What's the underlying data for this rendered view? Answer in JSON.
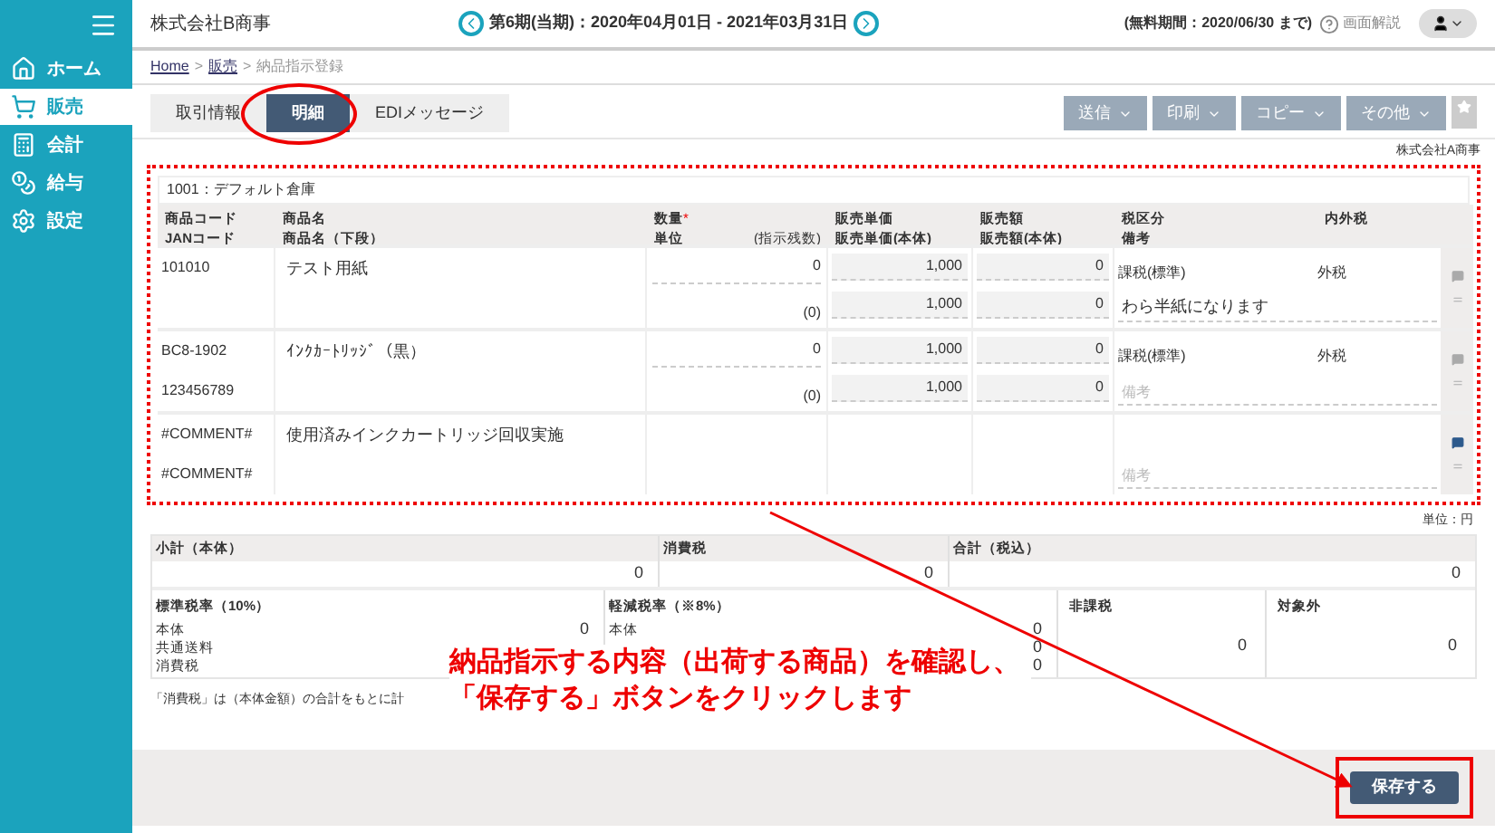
{
  "header": {
    "company": "株式会社B商事",
    "period": "第6期(当期)：2020年04月01日 - 2021年03月31日",
    "trial": "(無料期間：2020/06/30 まで)",
    "help": "画面解説"
  },
  "sidebar": {
    "items": [
      {
        "label": "ホーム",
        "selected": false
      },
      {
        "label": "販売",
        "selected": true
      },
      {
        "label": "会計",
        "selected": false
      },
      {
        "label": "給与",
        "selected": false
      },
      {
        "label": "設定",
        "selected": false
      }
    ]
  },
  "breadcrumb": [
    {
      "kind": "link",
      "label": "Home"
    },
    {
      "kind": "separator",
      "label": ">"
    },
    {
      "kind": "link",
      "label": "販売"
    },
    {
      "kind": "separator",
      "label": ">"
    },
    {
      "kind": "current",
      "label": "納品指示登録"
    }
  ],
  "tabs": [
    {
      "label": "取引情報",
      "selected": false
    },
    {
      "label": "明細",
      "selected": true
    },
    {
      "label": "EDIメッセージ",
      "selected": false
    }
  ],
  "actions": [
    {
      "label": "送信"
    },
    {
      "label": "印刷"
    },
    {
      "label": "コピー"
    },
    {
      "label": "その他"
    }
  ],
  "customer": "株式会社A商事",
  "detail": {
    "warehouse": "1001：デフォルト倉庫",
    "columns": [
      {
        "line1": "商品コード",
        "line2": "JANコード"
      },
      {
        "line1": "商品名",
        "line2": "商品名（下段）"
      },
      {
        "line1": "数量",
        "required_mark": "*",
        "line2": "単位",
        "line3": "(指示残数)"
      },
      {
        "line1": "販売単価",
        "line2": "販売単価(本体)"
      },
      {
        "line1": "販売額",
        "line2": "販売額(本体)"
      },
      {
        "line1": "税区分",
        "line2": "備考",
        "line3": "内外税"
      }
    ],
    "rows": [
      {
        "kind": "item",
        "code": "101010",
        "name": "テスト用紙",
        "qty": "0",
        "remain": "(0)",
        "unit_price": "1,000",
        "unit_price_base": "1,000",
        "amount": "0",
        "amount_base": "0",
        "tax_class": "課税(標準)",
        "inout": "外税",
        "memo": "わら半紙になります",
        "comment_active": false
      },
      {
        "kind": "item",
        "code": "BC8-1902",
        "jan": "123456789",
        "name": "ｲﾝｸｶｰﾄﾘｯｼﾞ（黒）",
        "qty": "0",
        "remain": "(0)",
        "unit_price": "1,000",
        "unit_price_base": "1,000",
        "amount": "0",
        "amount_base": "0",
        "tax_class": "課税(標準)",
        "inout": "外税",
        "memo_placeholder": "備考",
        "comment_active": false
      },
      {
        "kind": "comment",
        "code": "#COMMENT#",
        "jan": "#COMMENT#",
        "name": "使用済みインクカートリッジ回収実施",
        "memo_placeholder": "備考",
        "comment_active": true
      }
    ]
  },
  "summary": {
    "unit": "単位：円",
    "totals": [
      {
        "label": "小計（本体）",
        "value": "0"
      },
      {
        "label": "消費税",
        "value": "0"
      },
      {
        "label": "合計（税込）",
        "value": "0"
      }
    ],
    "standard": {
      "title": "標準税率（10%）",
      "rows": [
        {
          "label": "本体",
          "value": "0"
        },
        {
          "label": "共通送料"
        },
        {
          "label": "消費税"
        }
      ]
    },
    "reduced": {
      "title": "軽減税率（※8%）",
      "rows": [
        {
          "label": "本体",
          "value": "0"
        },
        {
          "value": "0"
        },
        {
          "value": "0"
        }
      ]
    },
    "exempt": {
      "title": "非課税",
      "value": "0"
    },
    "outside": {
      "title": "対象外",
      "value": "0"
    },
    "note": "「消費税」は（本体金額）の合計をもとに計"
  },
  "save_button": "保存する",
  "callout": [
    "納品指示する内容（出荷する商品）を確認し、",
    "「保存する」ボタンをクリックします"
  ]
}
